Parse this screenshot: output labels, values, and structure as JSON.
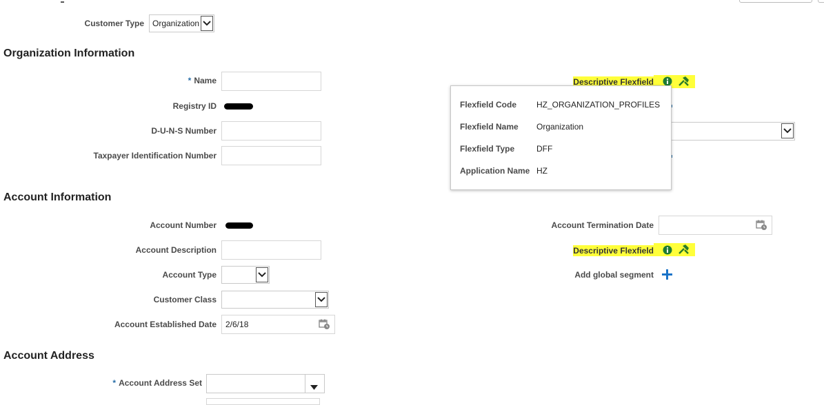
{
  "customer_type": {
    "label": "Customer Type",
    "value": "Organization"
  },
  "org_section": {
    "title": "Organization Information",
    "name_required": "*",
    "name_label": "Name",
    "registry_label": "Registry ID",
    "duns_label": "D-U-N-S Number",
    "taxpayer_label": "Taxpayer Identification Number",
    "flexfield_label": "Descriptive Flexfield"
  },
  "flexfield_popup": {
    "rows": [
      {
        "key": "Flexfield Code",
        "value": "HZ_ORGANIZATION_PROFILES"
      },
      {
        "key": "Flexfield Name",
        "value": "Organization"
      },
      {
        "key": "Flexfield Type",
        "value": "DFF"
      },
      {
        "key": "Application Name",
        "value": "HZ"
      }
    ]
  },
  "account_section": {
    "title": "Account Information",
    "number_label": "Account Number",
    "description_label": "Account Description",
    "type_label": "Account Type",
    "class_label": "Customer Class",
    "established_label": "Account Established Date",
    "established_value": "2/6/18",
    "termination_label": "Account Termination Date",
    "flexfield_label": "Descriptive Flexfield",
    "add_segment_label": "Add global segment"
  },
  "address_section": {
    "title": "Account Address",
    "set_required": "*",
    "set_label": "Account Address Set"
  },
  "colors": {
    "highlight": "#ffff3a",
    "info_icon": "#1e7b34",
    "add_icon": "#1a73c8"
  },
  "icons": [
    "info-icon",
    "tools-icon",
    "calendar-icon",
    "chevron-down-icon",
    "plus-icon"
  ]
}
